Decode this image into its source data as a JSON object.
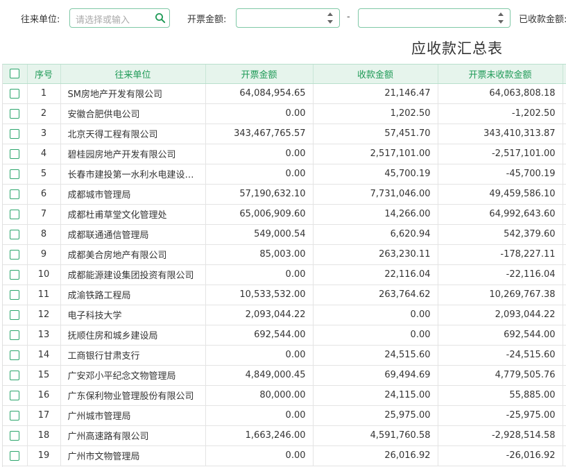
{
  "filters": {
    "unit_label": "往来单位:",
    "unit_placeholder": "请选择或输入",
    "invoice_label": "开票金额:",
    "range_sep": "-",
    "received_label": "已收款金额:"
  },
  "report": {
    "title": "应收款汇总表"
  },
  "table": {
    "columns": [
      "序号",
      "往来单位",
      "开票金额",
      "收款金额",
      "开票未收款金额"
    ],
    "rows": [
      {
        "idx": "1",
        "name": "SM房地产开发有限公司",
        "invoice": "64,084,954.65",
        "received": "21,146.47",
        "outstanding": "64,063,808.18"
      },
      {
        "idx": "2",
        "name": "安徽合肥供电公司",
        "invoice": "0.00",
        "received": "1,202.50",
        "outstanding": "-1,202.50"
      },
      {
        "idx": "3",
        "name": "北京天得工程有限公司",
        "invoice": "343,467,765.57",
        "received": "57,451.70",
        "outstanding": "343,410,313.87"
      },
      {
        "idx": "4",
        "name": "碧桂园房地产开发有限公司",
        "invoice": "0.00",
        "received": "2,517,101.00",
        "outstanding": "-2,517,101.00"
      },
      {
        "idx": "5",
        "name": "长春市建投第一水利水电建设…",
        "invoice": "0.00",
        "received": "45,700.19",
        "outstanding": "-45,700.19"
      },
      {
        "idx": "6",
        "name": "成都城市管理局",
        "invoice": "57,190,632.10",
        "received": "7,731,046.00",
        "outstanding": "49,459,586.10"
      },
      {
        "idx": "7",
        "name": "成都杜甫草堂文化管理处",
        "invoice": "65,006,909.60",
        "received": "14,266.00",
        "outstanding": "64,992,643.60"
      },
      {
        "idx": "8",
        "name": "成都联通通信管理局",
        "invoice": "549,000.54",
        "received": "6,620.94",
        "outstanding": "542,379.60"
      },
      {
        "idx": "9",
        "name": "成都美合房地产有限公司",
        "invoice": "85,003.00",
        "received": "263,230.11",
        "outstanding": "-178,227.11"
      },
      {
        "idx": "10",
        "name": "成都能源建设集团投资有限公司",
        "invoice": "0.00",
        "received": "22,116.04",
        "outstanding": "-22,116.04"
      },
      {
        "idx": "11",
        "name": "成渝铁路工程局",
        "invoice": "10,533,532.00",
        "received": "263,764.62",
        "outstanding": "10,269,767.38"
      },
      {
        "idx": "12",
        "name": "电子科技大学",
        "invoice": "2,093,044.22",
        "received": "0.00",
        "outstanding": "2,093,044.22"
      },
      {
        "idx": "13",
        "name": "抚顺住房和城乡建设局",
        "invoice": "692,544.00",
        "received": "0.00",
        "outstanding": "692,544.00"
      },
      {
        "idx": "14",
        "name": "工商银行甘肃支行",
        "invoice": "0.00",
        "received": "24,515.60",
        "outstanding": "-24,515.60"
      },
      {
        "idx": "15",
        "name": "广安邓小平纪念文物管理局",
        "invoice": "4,849,000.45",
        "received": "69,494.69",
        "outstanding": "4,779,505.76"
      },
      {
        "idx": "16",
        "name": "广东保利物业管理股份有限公司",
        "invoice": "80,000.00",
        "received": "24,115.00",
        "outstanding": "55,885.00"
      },
      {
        "idx": "17",
        "name": "广州城市管理局",
        "invoice": "0.00",
        "received": "25,975.00",
        "outstanding": "-25,975.00"
      },
      {
        "idx": "18",
        "name": "广州高速路有限公司",
        "invoice": "1,663,246.00",
        "received": "4,591,760.58",
        "outstanding": "-2,928,514.58"
      },
      {
        "idx": "19",
        "name": "广州市文物管理局",
        "invoice": "0.00",
        "received": "26,016.92",
        "outstanding": "-26,016.92"
      }
    ]
  },
  "colors": {
    "accent": "#1f9a57",
    "header_bg": "#e6f4ec",
    "border": "#7fc8a6"
  }
}
